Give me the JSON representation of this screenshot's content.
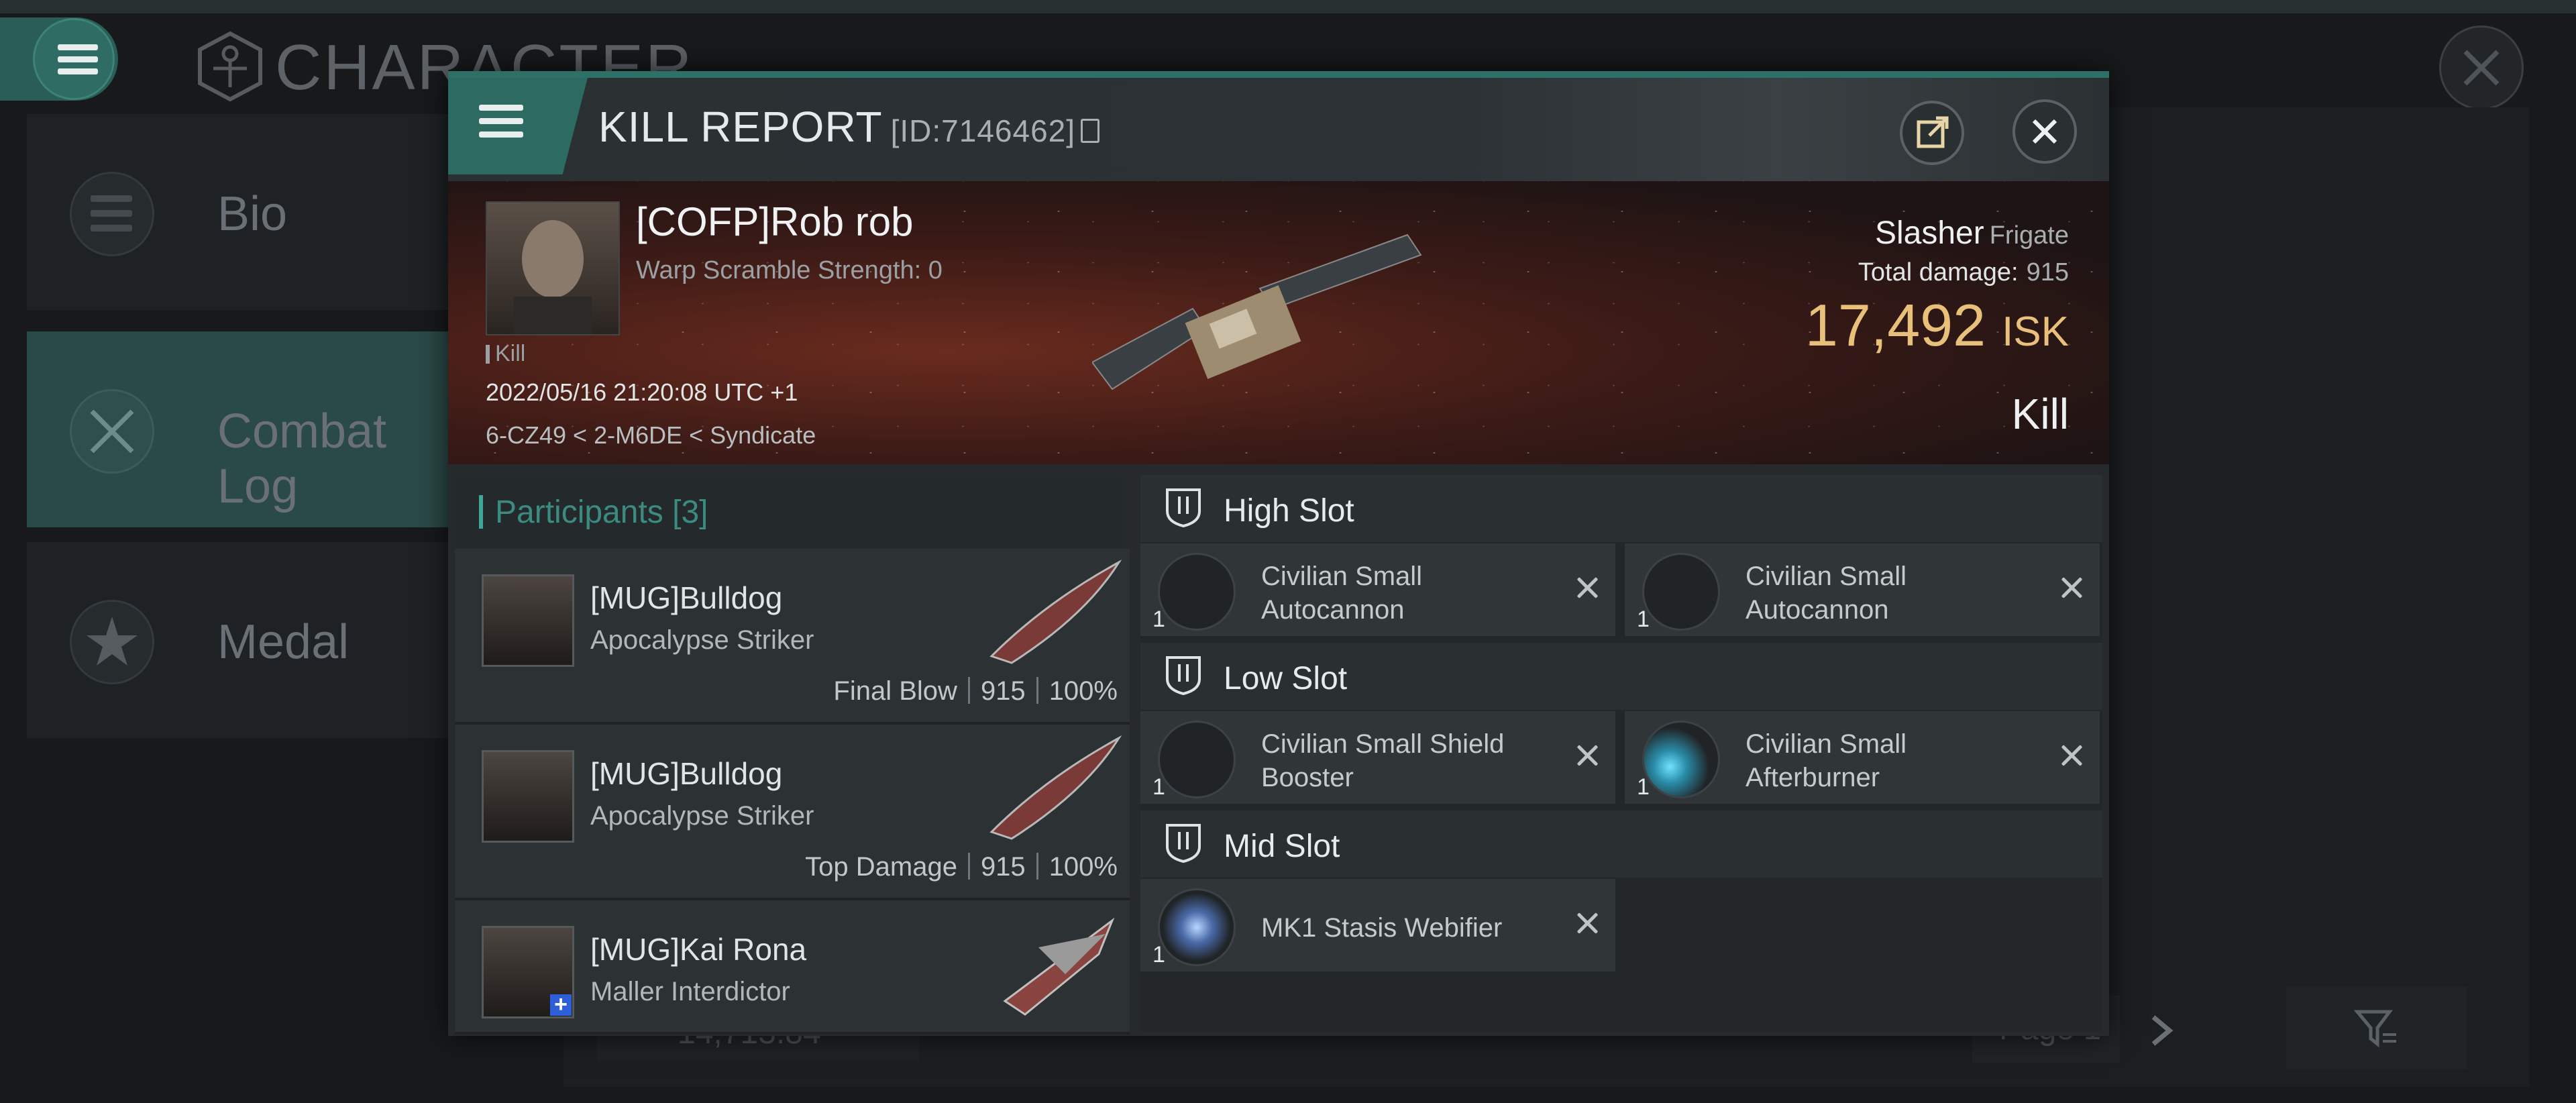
{
  "background": {
    "title": "CHARACTER",
    "sidebar": [
      {
        "label": "Bio",
        "icon": "list-icon"
      },
      {
        "label": "Combat Log",
        "icon": "crossed-swords-icon",
        "active": true
      },
      {
        "label": "Medal",
        "icon": "star-badge-icon"
      }
    ],
    "isk_value": "14,713.84",
    "page_label": "Page 1"
  },
  "dialog": {
    "title": "KILL REPORT",
    "id_text": "[ID:7146462]",
    "victim": {
      "name": "[COFP]Rob rob",
      "warp": "Warp Scramble Strength: 0",
      "tag": "Kill",
      "datetime": "2022/05/16 21:20:08 UTC +1",
      "location": "6-CZ49 < 2-M6DE < Syndicate",
      "ship": "Slasher",
      "ship_class": "Frigate",
      "total_damage_label": "Total damage:",
      "total_damage": "915",
      "isk": "17,492",
      "isk_unit": "ISK",
      "result": "Kill"
    },
    "participants": {
      "label": "Participants",
      "count": "[3]",
      "rows": [
        {
          "name": "[MUG]Bulldog",
          "ship": "Apocalypse Striker",
          "role": "Final Blow",
          "damage": "915",
          "percent": "100%"
        },
        {
          "name": "[MUG]Bulldog",
          "ship": "Apocalypse Striker",
          "role": "Top Damage",
          "damage": "915",
          "percent": "100%"
        },
        {
          "name": "[MUG]Kai Rona",
          "ship": "Maller Interdictor",
          "role": "",
          "damage": "",
          "percent": ""
        }
      ]
    },
    "slots": [
      {
        "label": "High Slot",
        "modules": [
          {
            "name": "Civilian Small Autocannon",
            "qty": "1"
          },
          {
            "name": "Civilian Small Autocannon",
            "qty": "1"
          }
        ]
      },
      {
        "label": "Low Slot",
        "modules": [
          {
            "name": "Civilian Small Shield Booster",
            "qty": "1"
          },
          {
            "name": "Civilian Small Afterburner",
            "qty": "1"
          }
        ]
      },
      {
        "label": "Mid Slot",
        "modules": [
          {
            "name": "MK1 Stasis Webifier",
            "qty": "1"
          }
        ]
      }
    ]
  },
  "colors": {
    "accent": "#2e6f68",
    "isk": "#e8c07a",
    "participants": "#3c8b81"
  }
}
